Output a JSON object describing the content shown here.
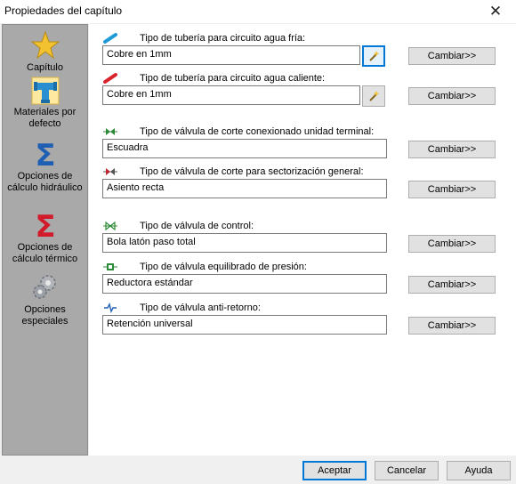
{
  "window": {
    "title": "Propiedades del capítulo",
    "close_glyph": "✕"
  },
  "sidebar": {
    "items": [
      {
        "label": "Capítulo",
        "icon": "star-icon"
      },
      {
        "label": "Materiales por defecto",
        "icon": "pipe-fitting-icon"
      },
      {
        "label": "Opciones de cálculo hidráulico",
        "icon": "sigma-blue-icon"
      },
      {
        "label": "Opciones de cálculo térmico",
        "icon": "sigma-red-icon"
      },
      {
        "label": "Opciones especiales",
        "icon": "gears-icon"
      }
    ]
  },
  "rows": [
    {
      "caption": "Tipo de tubería para circuito agua fría:",
      "value": "Cobre en 1mm",
      "button": "Cambiar>>"
    },
    {
      "caption": "Tipo de tubería para circuito agua caliente:",
      "value": "Cobre en 1mm",
      "button": "Cambiar>>"
    },
    {
      "caption": "Tipo de válvula de corte conexionado unidad terminal:",
      "value": "Escuadra",
      "button": "Cambiar>>"
    },
    {
      "caption": "Tipo de válvula de corte para sectorización general:",
      "value": "Asiento recta",
      "button": "Cambiar>>"
    },
    {
      "caption": "Tipo de válvula de control:",
      "value": "Bola latón paso total",
      "button": "Cambiar>>"
    },
    {
      "caption": "Tipo de válvula equilibrado de presión:",
      "value": "Reductora estándar",
      "button": "Cambiar>>"
    },
    {
      "caption": "Tipo de válvula anti-retorno:",
      "value": "Retención universal",
      "button": "Cambiar>>"
    }
  ],
  "footer": {
    "accept": "Aceptar",
    "cancel": "Cancelar",
    "help": "Ayuda"
  },
  "colors": {
    "sidebar_bg": "#a9a9a9",
    "accent": "#0078d7",
    "cold_pipe": "#1e9bd7",
    "hot_pipe": "#d9232d"
  }
}
